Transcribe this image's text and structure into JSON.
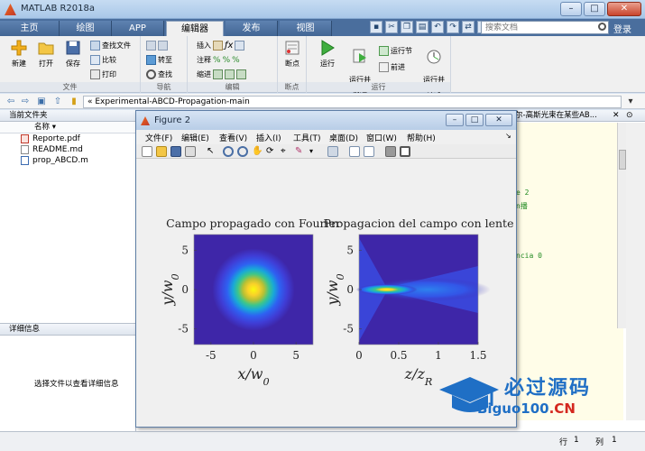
{
  "window": {
    "title": "MATLAB R2018a"
  },
  "tabs": [
    {
      "label": "主页"
    },
    {
      "label": "绘图"
    },
    {
      "label": "APP"
    },
    {
      "label": "编辑器"
    },
    {
      "label": "发布"
    },
    {
      "label": "视图"
    }
  ],
  "search": {
    "placeholder": "搜索文档"
  },
  "login_label": "登录",
  "ribbon": {
    "file": {
      "label": "文件",
      "new": "新建",
      "open": "打开",
      "save": "保存",
      "find_files": "查找文件",
      "compare": "比较",
      "print": "打印"
    },
    "navigate": {
      "label": "导航",
      "goto": "转至",
      "find": "查找"
    },
    "edit": {
      "label": "编辑",
      "insert": "插入",
      "comment": "注释",
      "indent": "缩进"
    },
    "breakpoints": {
      "label": "断点",
      "breakpoints_btn": "断点"
    },
    "run": {
      "label": "运行",
      "run": "运行",
      "run_advance": "运行并\n前进",
      "run_section": "运行节",
      "advance": "前进",
      "run_time": "运行并\n计时"
    }
  },
  "address": {
    "path": "« Experimental-ABCD-Propagation-main"
  },
  "current_folder": {
    "title": "当前文件夹",
    "col_name": "名称 ▾",
    "files": [
      {
        "name": "Reporte.pdf"
      },
      {
        "name": "README.md"
      },
      {
        "name": "prop_ABCD.m"
      }
    ]
  },
  "details": {
    "title": "详细信息",
    "message": "选择文件以查看详细信息"
  },
  "editor": {
    "header": "尔-高斯光束在某些AB...",
    "lines": [
      "e 2",
      "n播",
      "ncia 0"
    ]
  },
  "status": {
    "row_label": "行",
    "row": "1",
    "col_label": "列",
    "col": "1"
  },
  "figure": {
    "title": "Figure 2",
    "menus": [
      "文件(F)",
      "编辑(E)",
      "查看(V)",
      "插入(I)",
      "工具(T)",
      "桌面(D)",
      "窗口(W)",
      "帮助(H)"
    ]
  },
  "chart_data": [
    {
      "type": "heatmap",
      "title": "Campo propagado con Fourier",
      "xlabel": "x/w_0",
      "ylabel": "y/w_0",
      "xlim": [
        -7,
        7
      ],
      "ylim": [
        -7,
        7
      ],
      "xticks": [
        "-5",
        "0",
        "5"
      ],
      "yticks": [
        "5",
        "0",
        "-5"
      ],
      "description_data": {
        "shape": "gaussian",
        "center": [
          0,
          0
        ],
        "sigma": 2.2
      },
      "colormap": [
        "#3e26a8",
        "#2e61f2",
        "#18a8d8",
        "#3dc68a",
        "#b8c034",
        "#f9d12a",
        "#f9fb0e"
      ]
    },
    {
      "type": "heatmap",
      "title": "Propagacion del campo con lente",
      "xlabel": "z/z_R",
      "ylabel": "y/w_0",
      "xlim": [
        0,
        1.5
      ],
      "ylim": [
        -7,
        7
      ],
      "xticks": [
        "0",
        "0.5",
        "1",
        "1.5"
      ],
      "yticks": [
        "5",
        "0",
        "-5"
      ],
      "description_data": {
        "shape": "focused-beam",
        "focus_z": 0.35
      },
      "colormap": [
        "#3e26a8",
        "#2e61f2",
        "#18a8d8",
        "#3dc68a",
        "#b8c034",
        "#f9d12a",
        "#f9fb0e"
      ]
    }
  ],
  "watermark": {
    "cn": "必过源码",
    "en_main": "Biguo100",
    "en_suffix": ".CN"
  }
}
